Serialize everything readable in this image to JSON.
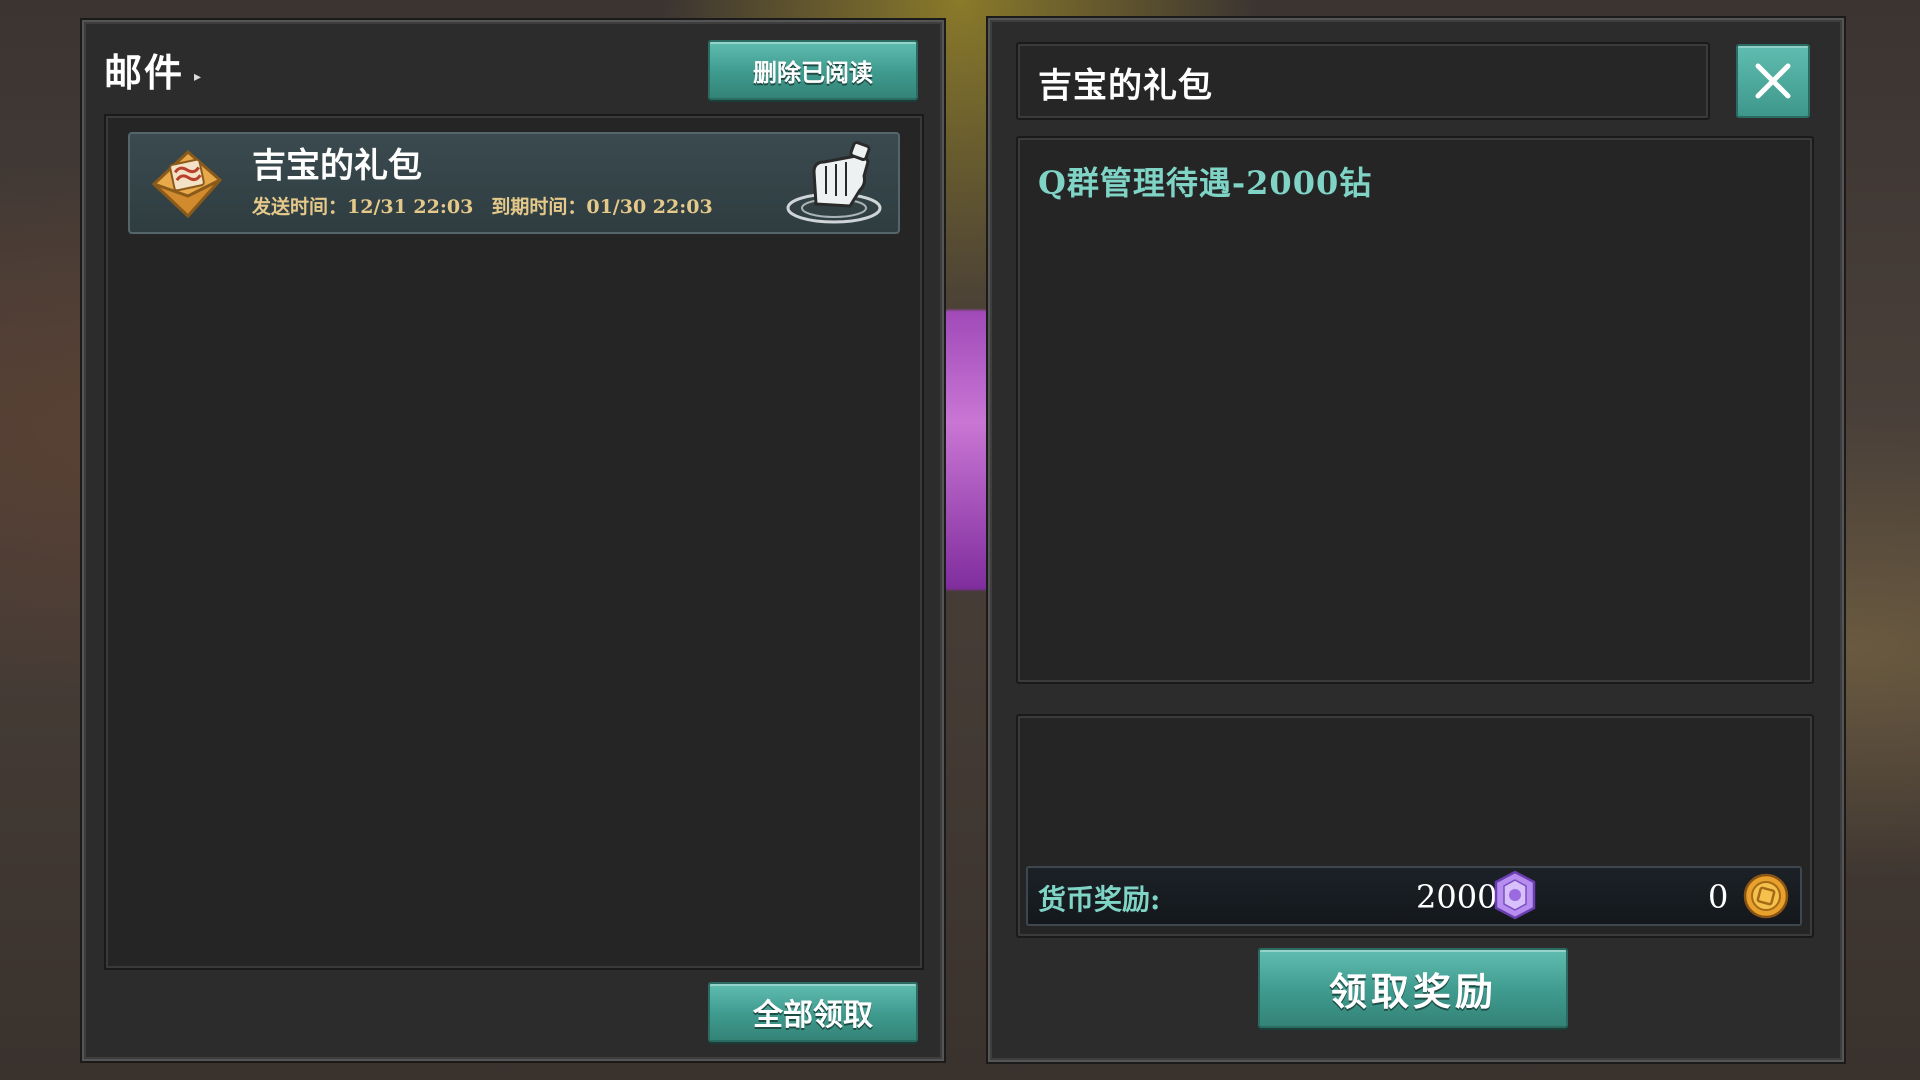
{
  "mailbox": {
    "title": "邮件",
    "title_arrow": "▸",
    "delete_read_label": "删除已阅读",
    "claim_all_label": "全部领取",
    "items": [
      {
        "title": "吉宝的礼包",
        "send_time": "发送时间：12/31 22:03",
        "expire_time": "到期时间：01/30 22:03",
        "icon": "envelope-icon",
        "attachment_icon": "glove-icon"
      }
    ]
  },
  "detail": {
    "title": "吉宝的礼包",
    "body": "Q群管理待遇-2000钻",
    "close_icon": "close-icon",
    "currency_label": "货币奖励:",
    "gem_amount": "2000",
    "gold_amount": "0",
    "claim_label": "领取奖励"
  },
  "colors": {
    "accent": "#4aa99c",
    "text_teal": "#7fd4c6",
    "date_gold": "#e4c98a"
  }
}
